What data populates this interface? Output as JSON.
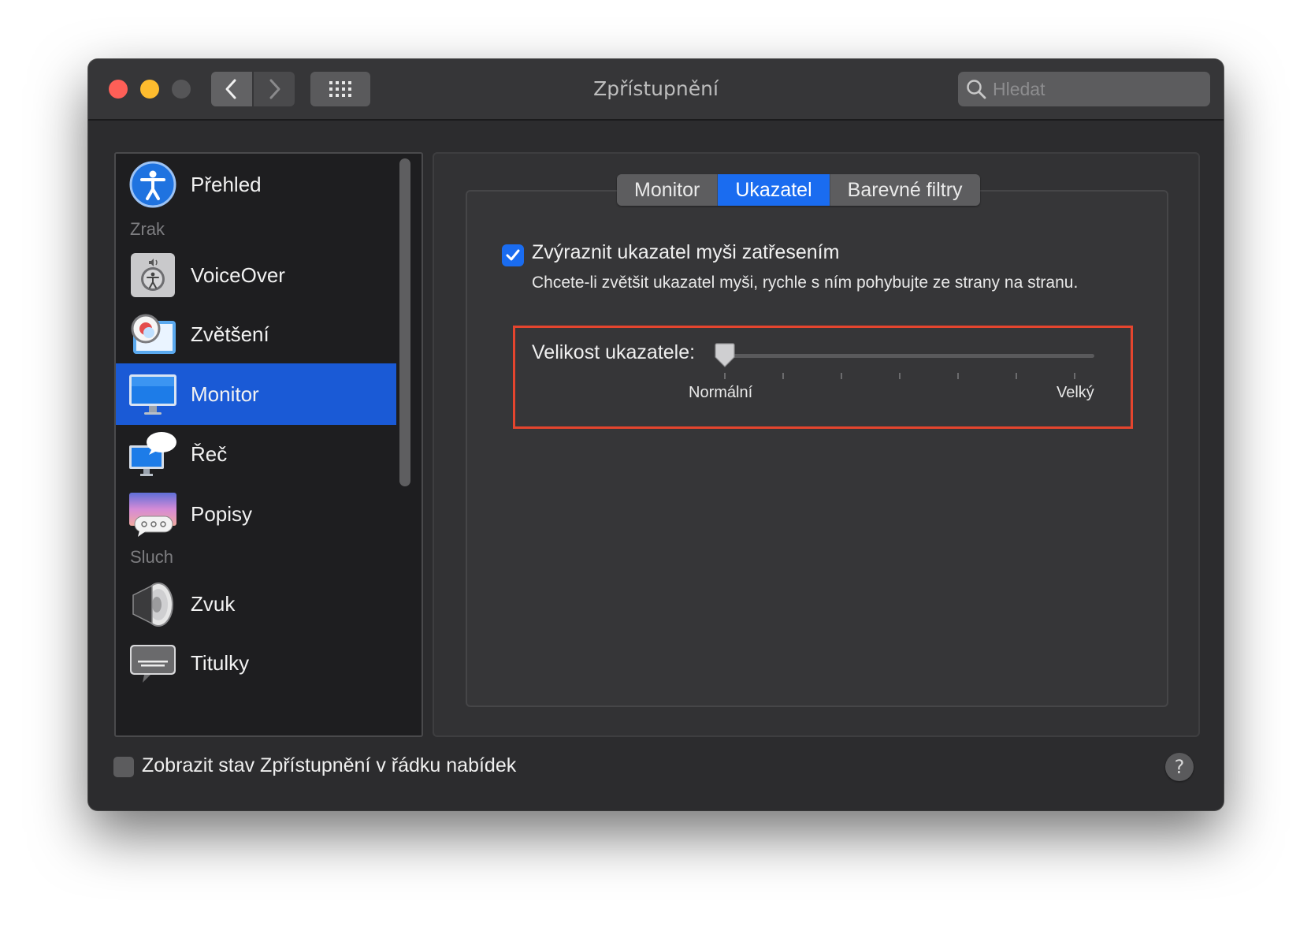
{
  "window": {
    "title": "Zpřístupnění",
    "search_placeholder": "Hledat"
  },
  "sidebar": {
    "items": [
      {
        "label": "Přehled",
        "icon": "accessibility-icon"
      },
      {
        "label": "VoiceOver",
        "icon": "voiceover-icon"
      },
      {
        "label": "Zvětšení",
        "icon": "zoom-icon"
      },
      {
        "label": "Monitor",
        "icon": "display-icon",
        "selected": true
      },
      {
        "label": "Řeč",
        "icon": "speech-icon"
      },
      {
        "label": "Popisy",
        "icon": "descriptions-icon"
      },
      {
        "label": "Zvuk",
        "icon": "speaker-icon"
      },
      {
        "label": "Titulky",
        "icon": "captions-icon"
      }
    ],
    "headers": {
      "vision": "Zrak",
      "hearing": "Sluch"
    }
  },
  "tabs": [
    {
      "label": "Monitor",
      "active": false
    },
    {
      "label": "Ukazatel",
      "active": true
    },
    {
      "label": "Barevné filtry",
      "active": false
    }
  ],
  "pointer": {
    "shake_checkbox_label": "Zvýraznit ukazatel myši zatřesením",
    "shake_checked": true,
    "description": "Chcete-li zvětšit ukazatel myši, rychle s ním pohybujte ze strany na stranu.",
    "size_label": "Velikost ukazatele:",
    "size_min_label": "Normální",
    "size_max_label": "Velký",
    "size_value": 0
  },
  "footer": {
    "menu_status_label": "Zobrazit stav Zpřístupnění v řádku nabídek",
    "menu_status_checked": false,
    "help_label": "?"
  },
  "colors": {
    "accent": "#1a6cf0",
    "selection": "#1a5ad6",
    "highlight_box": "#e5452e"
  }
}
